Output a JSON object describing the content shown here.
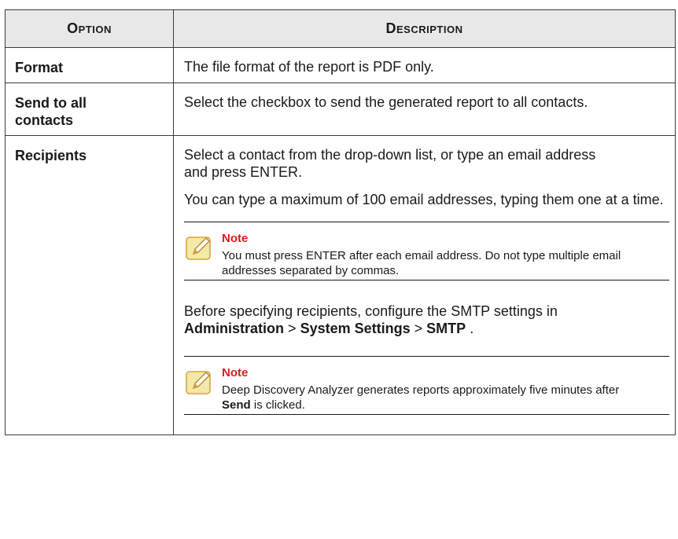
{
  "table": {
    "headers": [
      "Option",
      "Description"
    ],
    "rows": [
      {
        "option": "Format",
        "description": "The file format of the report is PDF only."
      },
      {
        "option": "Send to all contacts",
        "description": "Select the checkbox to send the generated report to all contacts."
      },
      {
        "option": "Recipients",
        "para1": "Select a contact from the drop-down list, or type an email address and press ENTER.",
        "para2": "You can type a maximum of 100 email addresses, typing them one at a time.",
        "note1": {
          "title": "Note",
          "text": "You must press ENTER after each email address. Do not type multiple email addresses separated by commas."
        },
        "para3_prefix": "Before specifying recipients, configure the SMTP settings in",
        "path1": "Administration",
        "sep1": ">",
        "path2": "System Settings",
        "sep2": ">",
        "path3": "SMTP",
        "period": ".",
        "note2": {
          "title": "Note",
          "text_prefix": "Deep Discovery Analyzer generates reports approximately five minutes after",
          "send_word": "Send",
          "text_suffix": "is clicked."
        }
      }
    ]
  },
  "icons": {
    "note": "note-pencil-icon"
  },
  "colors": {
    "note_title": "#e01a1a",
    "header_bg": "#e8e8e8",
    "icon_fill": "#f5e9a8",
    "icon_border": "#d8a53c"
  }
}
